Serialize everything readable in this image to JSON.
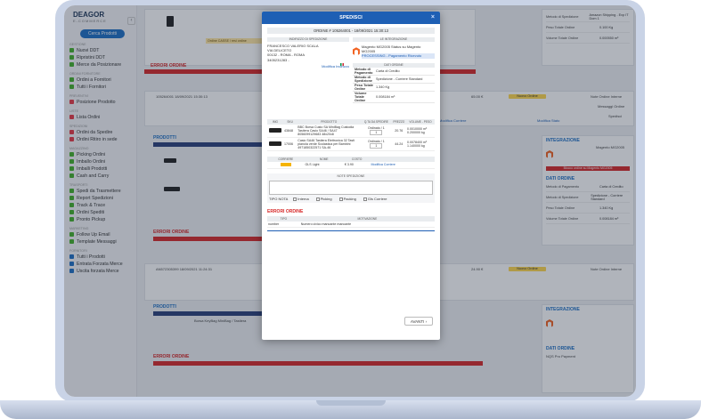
{
  "sidebar": {
    "logo": "DEAGOR",
    "logo_sub": "E-COMMERCE",
    "search_btn": "Cerca Prodotti",
    "groups": [
      {
        "title": "GESTIONE",
        "items": [
          "Nuovi DDT",
          "Ripristini DDT",
          "Merce da Posizionare"
        ]
      },
      {
        "title": "ORDINI FORNITORE",
        "items": [
          "Ordini a Fornitori",
          "Tutti i Fornitori"
        ]
      },
      {
        "title": "PREVENTIVI",
        "items": [
          "Posizione Prodotto"
        ]
      },
      {
        "title": "LISTE",
        "items": [
          "Lista Ordini"
        ]
      },
      {
        "title": "SPEDIZIONI",
        "items": [
          "Ordini da Spedire",
          "Ordini Ritiro in sede"
        ]
      },
      {
        "title": "MAGAZZINO",
        "items": [
          "Picking Ordini",
          "Imballo Ordini",
          "Imballi Prodotti",
          "Cash and Carry"
        ]
      },
      {
        "title": "TRASPORTI",
        "items": [
          "Spedi da Trasmettere",
          "Report Spedizioni",
          "Track & Trace",
          "Ordini Spediti",
          "Pronto Pickup"
        ]
      },
      {
        "title": "MARKETING",
        "items": [
          "Follow Up Email",
          "Template Messaggi"
        ]
      },
      {
        "title": "FORNITORI",
        "items": [
          "Tutti i Prodotti",
          "Entrata Forzata Merce",
          "Uscita forzata Merce"
        ]
      }
    ]
  },
  "modal": {
    "title": "SPEDISCI",
    "ordine": "ORDINE # 105264001 - 18/09/2021 15:30:13",
    "indirizzo_h": "INDIRIZZO DI SPEDIZIONE",
    "addr_lines": [
      "FRANCESCO VALERIO SCALA",
      "VIA DELICETO",
      "00132 - ROMA - ROMA",
      "3405231283 -"
    ],
    "modifica_indirizzo": "Modifica Indirizzo",
    "integrazione_h": "LE INTEGRAZIONE",
    "integrazione_text": "Magento MG2005 Status su Magento MG2005",
    "integrazione_status": "PROCESSING - Pagamento Ricevuto",
    "dati_h": "DATI ORDINE",
    "dati": [
      {
        "k": "Metodo di Pagamento",
        "v": "Carta di Credito"
      },
      {
        "k": "Metodo di Spedizione",
        "v": "Spedizione - Corriere Standard"
      },
      {
        "k": "Peso Totale Ordine",
        "v": "1.340 Kg"
      },
      {
        "k": "Volume Totale Ordine",
        "v": "0.008184 m³"
      }
    ],
    "prod_headers": [
      "IMG",
      "SKU",
      "PRODOTTO",
      "Q.TA DA SPEDIRE",
      "PREZZO",
      "VOLUME - PESO"
    ],
    "products": [
      {
        "sku": "43848",
        "name": "BBC Borsa Custo SA MiniBag Custodia Tastiera Casio SA46 / SA47 8056099129683 48x20x8",
        "qty_label": "Ordinato / 1",
        "qty": "1",
        "price": "20.76",
        "vol": "0.0010000 m³",
        "weight": "0.200000 kg"
      },
      {
        "sku": "17006",
        "name": "Casio SA46 Tastiera Elettronica 32 Tasti pianola verde Scolastica per Bambini 4971850322571 SA-46",
        "qty_label": "Ordinato / 1",
        "qty": "1",
        "price": "44.24",
        "vol": "0.0078400 m³",
        "weight": "1.140000 kg"
      }
    ],
    "courier_headers": [
      "CORRIERE",
      "NOME",
      "COSTO"
    ],
    "courier": {
      "name": "GLS Light",
      "cost": "€ 3.90",
      "modify": "Modifica Corriere"
    },
    "note_h": "NOTE SPEDIZIONE",
    "tipo_nota": "TIPO NOTA",
    "note_types": [
      "Interna",
      "Picking",
      "Packing",
      "Gls Corriere"
    ],
    "errori_h": "ERRORI ORDINE",
    "errori_headers": [
      "TIPO",
      "MOTIVAZIONE"
    ],
    "errori_row": {
      "tipo": "number",
      "mot": "Numero civico mancante mancante"
    },
    "avanti": "AVANTI"
  },
  "background": {
    "order1": "105264001 18/09/2021 15:30:13",
    "order2": "AN572305399 18/09/2021 11:24:31",
    "prodotti_h": "PRODOTTI",
    "errori_h": "ERRORI ORDINE",
    "integrazione_h": "INTEGRAZIONE",
    "dati_h": "DATI ORDINE",
    "status_pill": "Nuovo Ordine",
    "note_interne": "Note Ordine Interne",
    "messaggi": "Messaggi Ordine",
    "spedisci": "Spedisci",
    "modifica_stato": "Modifica Stato",
    "modifica_corriere": "Modifica Corriere",
    "magento_text": "Magento MG2005",
    "magento_status": "PROCESSING - Pagamento Ricevuto",
    "red_pill": "Blocco ordine su Magento MG2005",
    "right_rows": [
      {
        "k": "Metodo di Pagamento",
        "v": "Carta di Credito"
      },
      {
        "k": "Metodo di Spedizione",
        "v": "Spedizione - Corriere Standard"
      },
      {
        "k": "Peso Totale Ordine",
        "v": "1.340 Kg"
      },
      {
        "k": "Volume Totale Ordine",
        "v": "0.008184 m³"
      }
    ],
    "top_rows": [
      {
        "k": "Metodo di Spedizione",
        "v": "Amazon Shipping - Exp IT Dom 1"
      },
      {
        "k": "Peso Totale Ordine",
        "v": "0.100 Kg"
      },
      {
        "k": "Volume Totale Ordine",
        "v": "0.000550 m³"
      }
    ],
    "warn": "Ordine CASSE / resi ordine",
    "price1": "65.00 €",
    "price2": "24.90 €",
    "row2_name": "Borsa KeyBag MiniBag / Tastiera",
    "mg_nqs": "NQS Pro Payment"
  }
}
